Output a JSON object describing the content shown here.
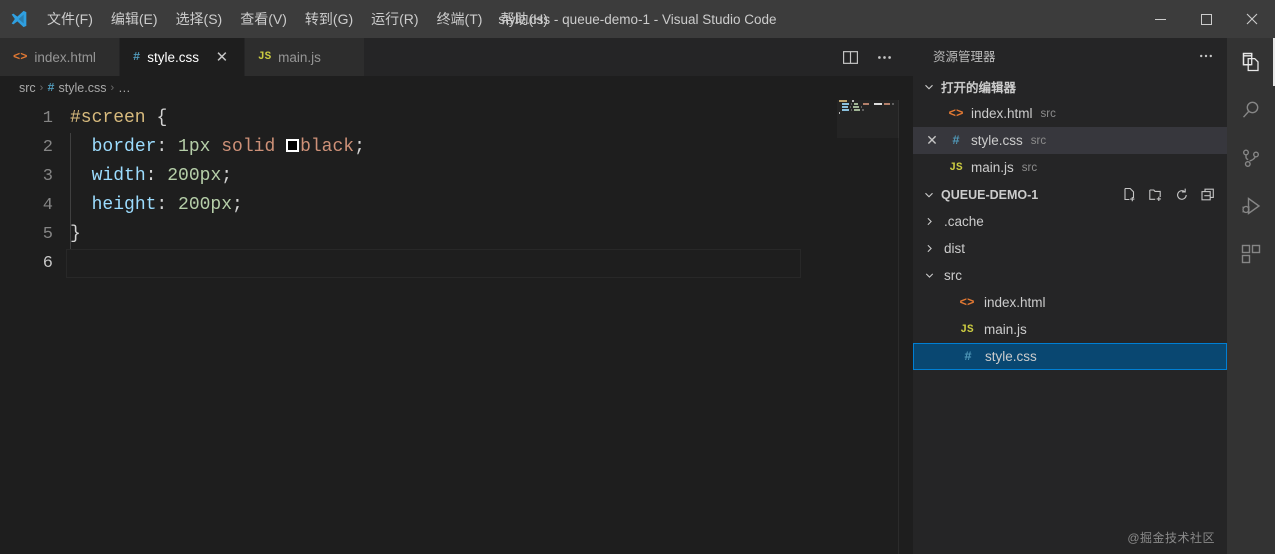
{
  "window": {
    "title": "style.css - queue-demo-1 - Visual Studio Code",
    "controls": {
      "minimize": "−",
      "maximize": "▢",
      "close": "✕"
    }
  },
  "menubar": {
    "logo_name": "vscode-logo",
    "items": [
      {
        "label": "文件(F)",
        "name": "menu-file"
      },
      {
        "label": "编辑(E)",
        "name": "menu-edit"
      },
      {
        "label": "选择(S)",
        "name": "menu-selection"
      },
      {
        "label": "查看(V)",
        "name": "menu-view"
      },
      {
        "label": "转到(G)",
        "name": "menu-go"
      },
      {
        "label": "运行(R)",
        "name": "menu-run"
      },
      {
        "label": "终端(T)",
        "name": "menu-terminal"
      },
      {
        "label": "帮助(H)",
        "name": "menu-help"
      }
    ]
  },
  "tabs": [
    {
      "label": "index.html",
      "icon": "<>",
      "icon_kind": "html",
      "active": false,
      "closable": false
    },
    {
      "label": "style.css",
      "icon": "#",
      "icon_kind": "css",
      "active": true,
      "closable": true
    },
    {
      "label": "main.js",
      "icon": "JS",
      "icon_kind": "js",
      "active": false,
      "closable": false
    }
  ],
  "tab_close_glyph": "✕",
  "editor_actions": {
    "split_label": "split-editor",
    "more_label": "⋯"
  },
  "breadcrumb": {
    "folder": "src",
    "file": "style.css",
    "symbol": "…",
    "separator": "›",
    "file_icon": "#"
  },
  "code": {
    "language": "css",
    "lines": [
      {
        "no": "1",
        "tokens": [
          {
            "t": "#screen",
            "c": "sel"
          },
          {
            "t": " ",
            "c": "punc"
          },
          {
            "t": "{",
            "c": "brace"
          }
        ]
      },
      {
        "no": "2",
        "tokens": [
          {
            "t": "  ",
            "c": "punc"
          },
          {
            "t": "border",
            "c": "prop"
          },
          {
            "t": ": ",
            "c": "punc"
          },
          {
            "t": "1px",
            "c": "num"
          },
          {
            "t": " ",
            "c": "punc"
          },
          {
            "t": "solid",
            "c": "val"
          },
          {
            "t": " ",
            "c": "punc"
          },
          {
            "t": "@swatch",
            "c": "swatch"
          },
          {
            "t": "black",
            "c": "val"
          },
          {
            "t": ";",
            "c": "punc"
          }
        ]
      },
      {
        "no": "3",
        "tokens": [
          {
            "t": "  ",
            "c": "punc"
          },
          {
            "t": "width",
            "c": "prop"
          },
          {
            "t": ": ",
            "c": "punc"
          },
          {
            "t": "200px",
            "c": "num"
          },
          {
            "t": ";",
            "c": "punc"
          }
        ]
      },
      {
        "no": "4",
        "tokens": [
          {
            "t": "  ",
            "c": "punc"
          },
          {
            "t": "height",
            "c": "prop"
          },
          {
            "t": ": ",
            "c": "punc"
          },
          {
            "t": "200px",
            "c": "num"
          },
          {
            "t": ";",
            "c": "punc"
          }
        ]
      },
      {
        "no": "5",
        "tokens": [
          {
            "t": "}",
            "c": "brace"
          }
        ]
      },
      {
        "no": "6",
        "tokens": []
      }
    ],
    "cursor_line": 6,
    "swatch_color": "#000000"
  },
  "sidebar": {
    "title": "资源管理器",
    "more_label": "⋯",
    "open_editors": {
      "title": "打开的编辑器",
      "expanded": true,
      "items": [
        {
          "name": "index.html",
          "desc": "src",
          "icon": "<>",
          "icon_kind": "html",
          "active": false,
          "dirty_close": false
        },
        {
          "name": "style.css",
          "desc": "src",
          "icon": "#",
          "icon_kind": "css",
          "active": true,
          "dirty_close": true
        },
        {
          "name": "main.js",
          "desc": "src",
          "icon": "JS",
          "icon_kind": "js",
          "active": false,
          "dirty_close": false
        }
      ],
      "close_glyph": "✕"
    },
    "workspace": {
      "title": "QUEUE-DEMO-1",
      "expanded": true,
      "actions": [
        "new-file",
        "new-folder",
        "refresh",
        "collapse-all"
      ],
      "tree": [
        {
          "label": ".cache",
          "type": "folder",
          "expanded": false,
          "depth": 0,
          "selected": false
        },
        {
          "label": "dist",
          "type": "folder",
          "expanded": false,
          "depth": 0,
          "selected": false
        },
        {
          "label": "src",
          "type": "folder",
          "expanded": true,
          "depth": 0,
          "selected": false
        },
        {
          "label": "index.html",
          "type": "file",
          "icon": "<>",
          "icon_kind": "html",
          "depth": 1,
          "selected": false
        },
        {
          "label": "main.js",
          "type": "file",
          "icon": "JS",
          "icon_kind": "js",
          "depth": 1,
          "selected": false
        },
        {
          "label": "style.css",
          "type": "file",
          "icon": "#",
          "icon_kind": "css",
          "depth": 1,
          "selected": true
        }
      ]
    },
    "watermark": "@掘金技术社区"
  },
  "activitybar": {
    "items": [
      {
        "name": "explorer",
        "active": true
      },
      {
        "name": "search",
        "active": false
      },
      {
        "name": "source-control",
        "active": false
      },
      {
        "name": "run-and-debug",
        "active": false
      },
      {
        "name": "extensions",
        "active": false
      }
    ]
  },
  "colors": {
    "titlebar_bg": "#3c3c3c",
    "editor_bg": "#1e1e1e",
    "sidebar_bg": "#252526",
    "activitybar_bg": "#333333",
    "selection_blue": "#094771",
    "focus_border": "#007fd4",
    "css_icon": "#519aba",
    "html_icon": "#e37933",
    "js_icon": "#cbcb41"
  }
}
